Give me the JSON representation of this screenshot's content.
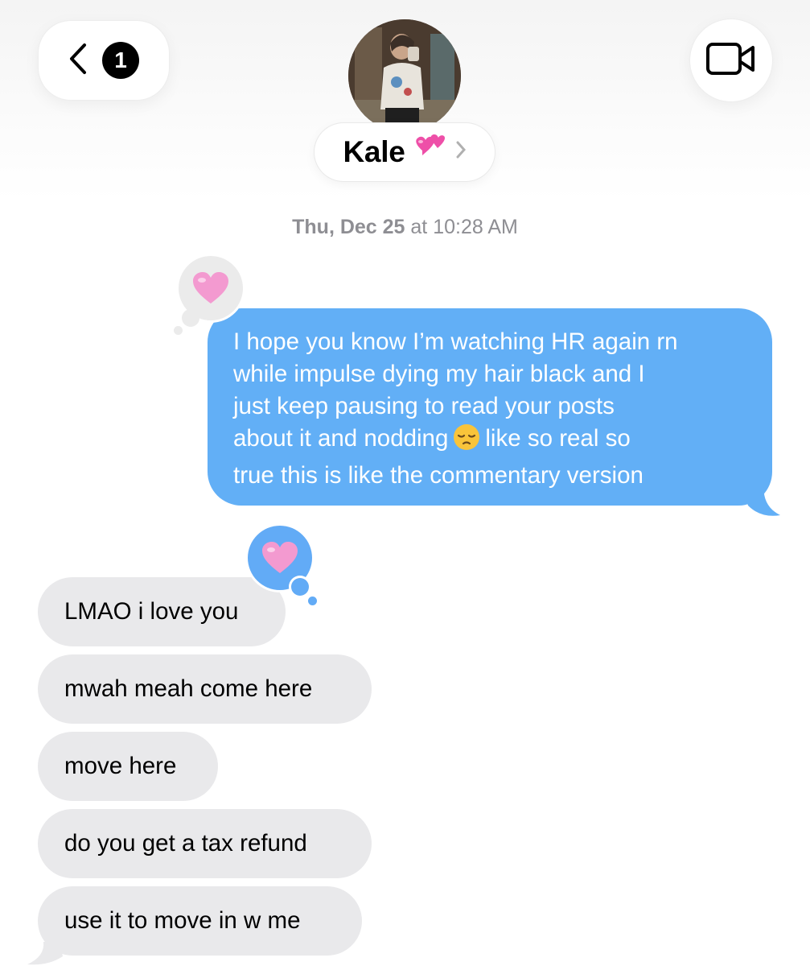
{
  "header": {
    "back_badge_count": "1",
    "contact_name": "Kale",
    "contact_emoji": "💕",
    "icons": [
      "chevron-left-icon",
      "video-camera-icon",
      "chevron-right-icon"
    ]
  },
  "conversation": {
    "timestamp_day": "Thu, Dec 25",
    "timestamp_sep": "at",
    "timestamp_time": "10:28 AM",
    "sent_message": {
      "line1": "I hope you know I’m watching HR again rn",
      "line2": "while impulse dying my hair black and I",
      "line3": "just keep pausing to read your posts",
      "line4a": "about it and nodding",
      "line4b": "like so real so",
      "line5": "true this is like the commentary version",
      "tapback": "heart"
    },
    "received_messages": [
      {
        "text": "LMAO i love you",
        "tapback": "heart"
      },
      {
        "text": "mwah meah come here"
      },
      {
        "text": "move here"
      },
      {
        "text": "do you get a tax refund"
      },
      {
        "text": "use it to move in w me"
      }
    ]
  },
  "colors": {
    "sent_bubble": "#62aff6",
    "received_bubble": "#e9e9eb",
    "timestamp": "#8e8e93",
    "heart": "#f39ad0"
  }
}
